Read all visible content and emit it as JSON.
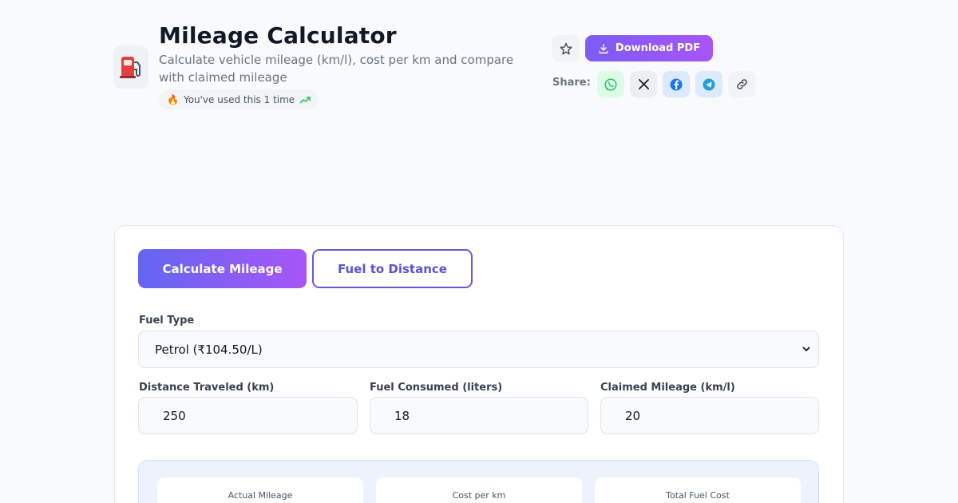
{
  "header": {
    "icon": "fuel-pump-icon",
    "title": "Mileage Calculator",
    "subtitle": "Calculate vehicle mileage (km/l), cost per km and compare with claimed mileage",
    "usage_text": "You've used this 1 time"
  },
  "actions": {
    "download_label": "Download PDF",
    "share_label": "Share:"
  },
  "tabs": [
    {
      "label": "Calculate Mileage",
      "active": true
    },
    {
      "label": "Fuel to Distance",
      "active": false
    }
  ],
  "form": {
    "fuel_type": {
      "label": "Fuel Type",
      "value": "Petrol (₹104.50/L)"
    },
    "distance": {
      "label": "Distance Traveled (km)",
      "value": "250"
    },
    "fuel": {
      "label": "Fuel Consumed (liters)",
      "value": "18"
    },
    "claimed": {
      "label": "Claimed Mileage (km/l)",
      "value": "20"
    }
  },
  "results": [
    {
      "label": "Actual Mileage"
    },
    {
      "label": "Cost per km"
    },
    {
      "label": "Total Fuel Cost"
    }
  ],
  "colors": {
    "accent": "#6366f1",
    "accent_end": "#a855f7"
  }
}
